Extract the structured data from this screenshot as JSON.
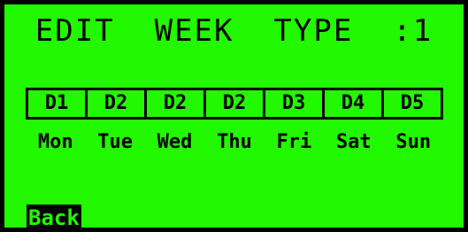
{
  "screen": {
    "title": "EDIT  WEEK  TYPE  :1",
    "day_types": [
      "D1",
      "D2",
      "D2",
      "D2",
      "D3",
      "D4",
      "D5"
    ],
    "day_names": [
      "Mon",
      "Tue",
      "Wed",
      "Thu",
      "Fri",
      "Sat",
      "Sun"
    ],
    "back_label": "Back"
  },
  "colors": {
    "background": "#22f800",
    "foreground": "#000000",
    "selected_background": "#000000",
    "selected_foreground": "#22f800"
  }
}
